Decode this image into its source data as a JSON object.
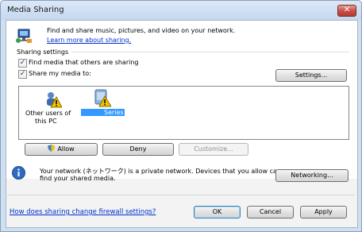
{
  "window": {
    "title": "Media Sharing",
    "close_glyph": "✕"
  },
  "intro": {
    "text": "Find and share music, pictures, and video on your network.",
    "link": "Learn more about sharing."
  },
  "settings": {
    "label": "Sharing settings",
    "find_media": {
      "label": "Find media that others are sharing",
      "checked": true
    },
    "share_media": {
      "label": "Share my media to:",
      "checked": true
    },
    "settings_button": "Settings..."
  },
  "devices": [
    {
      "label_line1": "Other users of",
      "label_line2": "this PC",
      "icon": "users-warning-icon"
    },
    {
      "label": "Series",
      "icon": "projector-warning-icon",
      "selected": true
    }
  ],
  "actions": {
    "allow": "Allow",
    "deny": "Deny",
    "customize": "Customize..."
  },
  "network": {
    "text_line1": "Your network (ネットワーク) is a private network. Devices that you allow can",
    "text_line2": "find your shared media.",
    "button": "Networking..."
  },
  "footer": {
    "firewall_link": "How does sharing change firewall settings?",
    "ok": "OK",
    "cancel": "Cancel",
    "apply": "Apply"
  },
  "colors": {
    "accent": "#0033cc",
    "selection": "#3399ff",
    "close": "#c75050"
  }
}
